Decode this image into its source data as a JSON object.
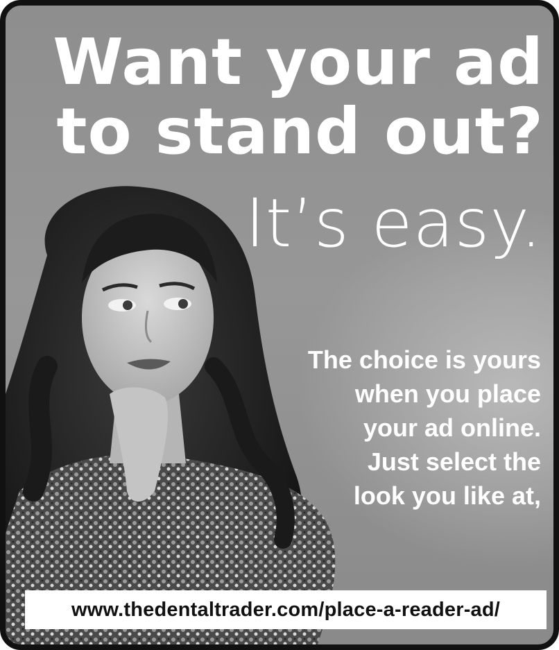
{
  "headline": {
    "line1": "Want your ad",
    "line2": "to stand out?",
    "line3": "It’s easy."
  },
  "body": {
    "lines": [
      "The choice is yours",
      "when you place",
      "your ad online.",
      "Just select the",
      "look you like at,"
    ]
  },
  "url": "www.thedentaltrader.com/place-a-reader-ad/",
  "colors": {
    "background": "#909090",
    "text": "#ffffff",
    "border": "#111111",
    "url_bar": "#ffffff"
  },
  "image": {
    "description_icon": "woman-portrait-photo"
  }
}
